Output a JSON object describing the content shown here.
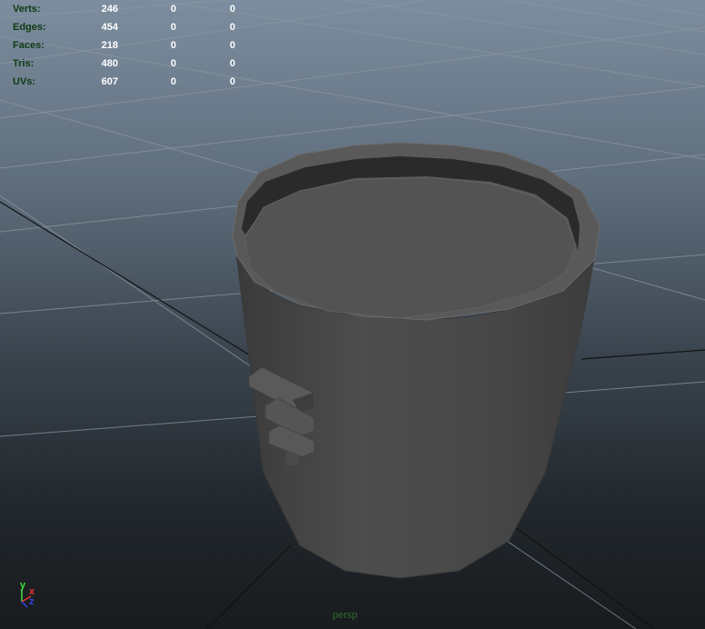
{
  "stats": [
    {
      "label": "Verts:",
      "values": [
        "246",
        "0",
        "0"
      ]
    },
    {
      "label": "Edges:",
      "values": [
        "454",
        "0",
        "0"
      ]
    },
    {
      "label": "Faces:",
      "values": [
        "218",
        "0",
        "0"
      ]
    },
    {
      "label": "Tris:",
      "values": [
        "480",
        "0",
        "0"
      ]
    },
    {
      "label": "UVs:",
      "values": [
        "607",
        "0",
        "0"
      ]
    }
  ],
  "camera": {
    "label": "persp"
  },
  "axis": {
    "y": "y",
    "x": "x",
    "z": "z"
  },
  "colors": {
    "label": "#0f3a12",
    "value": "#ffffff",
    "mesh": "#4b4b4b",
    "grid": "#8a949e",
    "grid_axis": "#000000",
    "axis_y": "#44dd44",
    "axis_x": "#ee3333",
    "axis_z": "#3344ee"
  }
}
